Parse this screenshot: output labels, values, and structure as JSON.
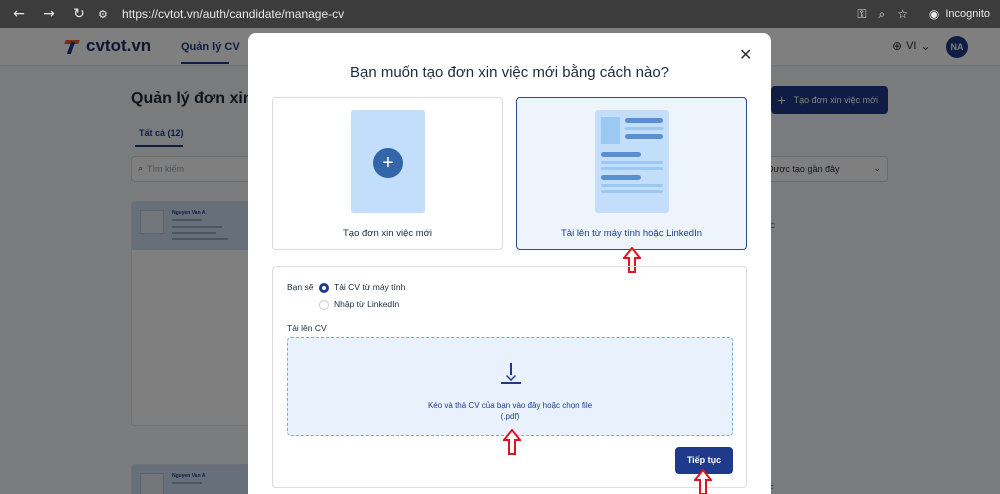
{
  "browser": {
    "url": "https://cvtot.vn/auth/candidate/manage-cv",
    "incognito_label": "Incognito",
    "nav_icons": [
      "back-icon",
      "forward-icon",
      "reload-icon"
    ]
  },
  "site": {
    "logo_text": "cvtot.vn",
    "nav_manage": "Quản lý CV",
    "lang": "VI",
    "avatar_initials": "NA",
    "page_title": "Quản lý đơn xin việc",
    "tab_all": "Tất cả (12)",
    "search_placeholder": "Tìm kiếm",
    "create_button": "Tạo đơn xin việc mới",
    "sort_value": "Được tạo gần đây",
    "card_name": "Nguyen Van A",
    "card_fragment": "C",
    "card_fragment_2": "c"
  },
  "modal": {
    "title": "Bạn muốn tạo đơn xin việc mới bằng cách nào?",
    "option_new_label": "Tạo đơn xin việc mới",
    "option_upload_label": "Tải lên từ máy tính hoặc LinkedIn",
    "ban_se_label": "Bạn sẽ",
    "radio_computer": "Tải CV từ máy tính",
    "radio_linkedin": "Nhập từ LinkedIn",
    "upload_label": "Tải lên CV",
    "dropzone_line1": "Kéo và thả CV của bạn vào đây hoặc chọn file",
    "dropzone_line2": "(.pdf)",
    "continue_button": "Tiếp tục"
  },
  "colors": {
    "primary": "#1f3a8a",
    "accent_orange": "#f05a28",
    "annotation_red": "#e0141e",
    "selected_bg": "#edf4fc"
  }
}
